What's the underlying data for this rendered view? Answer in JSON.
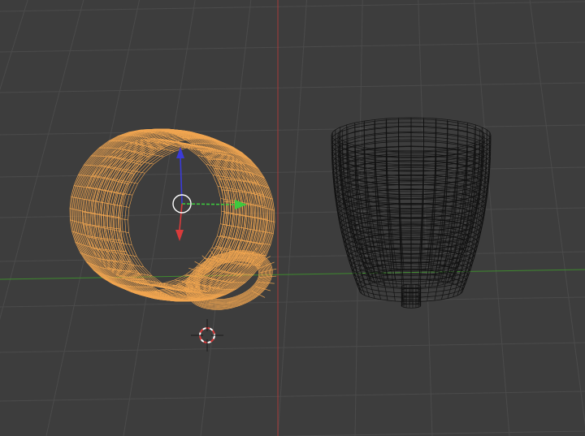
{
  "viewport": {
    "kind": "3d-viewport",
    "shading": "wireframe",
    "background_color": "#3d3d3d",
    "grid_color": "#4b4b4b",
    "x_axis_color": "#a83a3a",
    "y_axis_color": "#3e8a2e"
  },
  "objects": [
    {
      "name": "mug",
      "icon": "mug-wireframe-icon",
      "selected": true,
      "wire_color": "#f0a550"
    },
    {
      "name": "cup",
      "icon": "cup-wireframe-icon",
      "selected": false,
      "wire_color": "#111111"
    }
  ],
  "transform_gizmo": {
    "mode": "translate",
    "axis_colors": {
      "x": "#d93b3b",
      "y": "#3ec93e",
      "z": "#3b3bd9"
    }
  },
  "cursor_3d": {
    "icon": "3d-cursor-icon",
    "ring_colors": [
      "#ffffff",
      "#d93b3b"
    ]
  }
}
